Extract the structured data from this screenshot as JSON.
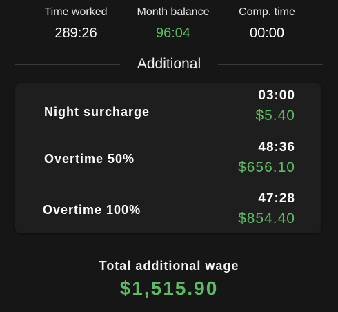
{
  "summary": {
    "time_worked": {
      "label": "Time worked",
      "value": "289:26"
    },
    "month_balance": {
      "label": "Month balance",
      "value": "96:04",
      "color": "#5dbb63"
    },
    "comp_time": {
      "label": "Comp. time",
      "value": "00:00"
    }
  },
  "additional": {
    "title": "Additional",
    "rows": [
      {
        "label": "Night surcharge",
        "time": "03:00",
        "amount": "$5.40"
      },
      {
        "label": "Overtime 50%",
        "time": "48:36",
        "amount": "$656.10"
      },
      {
        "label": "Overtime 100%",
        "time": "47:28",
        "amount": "$854.40"
      }
    ]
  },
  "total": {
    "label": "Total additional wage",
    "value": "$1,515.90"
  },
  "colors": {
    "background": "#161616",
    "card": "#1e1e1e",
    "accent_green": "#5dbb63"
  }
}
